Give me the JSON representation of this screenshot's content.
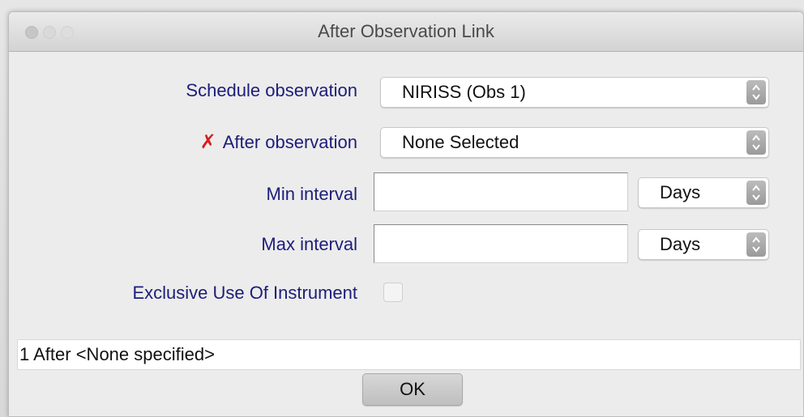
{
  "window": {
    "title": "After Observation Link"
  },
  "form": {
    "schedule_observation": {
      "label": "Schedule observation",
      "value": "NIRISS (Obs 1)"
    },
    "after_observation": {
      "error_icon": "x-mark-icon",
      "label": "After observation",
      "value": "None Selected"
    },
    "min_interval": {
      "label": "Min interval",
      "value": "",
      "unit": "Days"
    },
    "max_interval": {
      "label": "Max interval",
      "value": "",
      "unit": "Days"
    },
    "exclusive_use": {
      "label": "Exclusive Use Of Instrument",
      "checked": false
    }
  },
  "status_text": "1 After <None specified>",
  "ok_label": "OK",
  "colors": {
    "label_text": "#1d1d7a",
    "error": "#d81e1e"
  }
}
